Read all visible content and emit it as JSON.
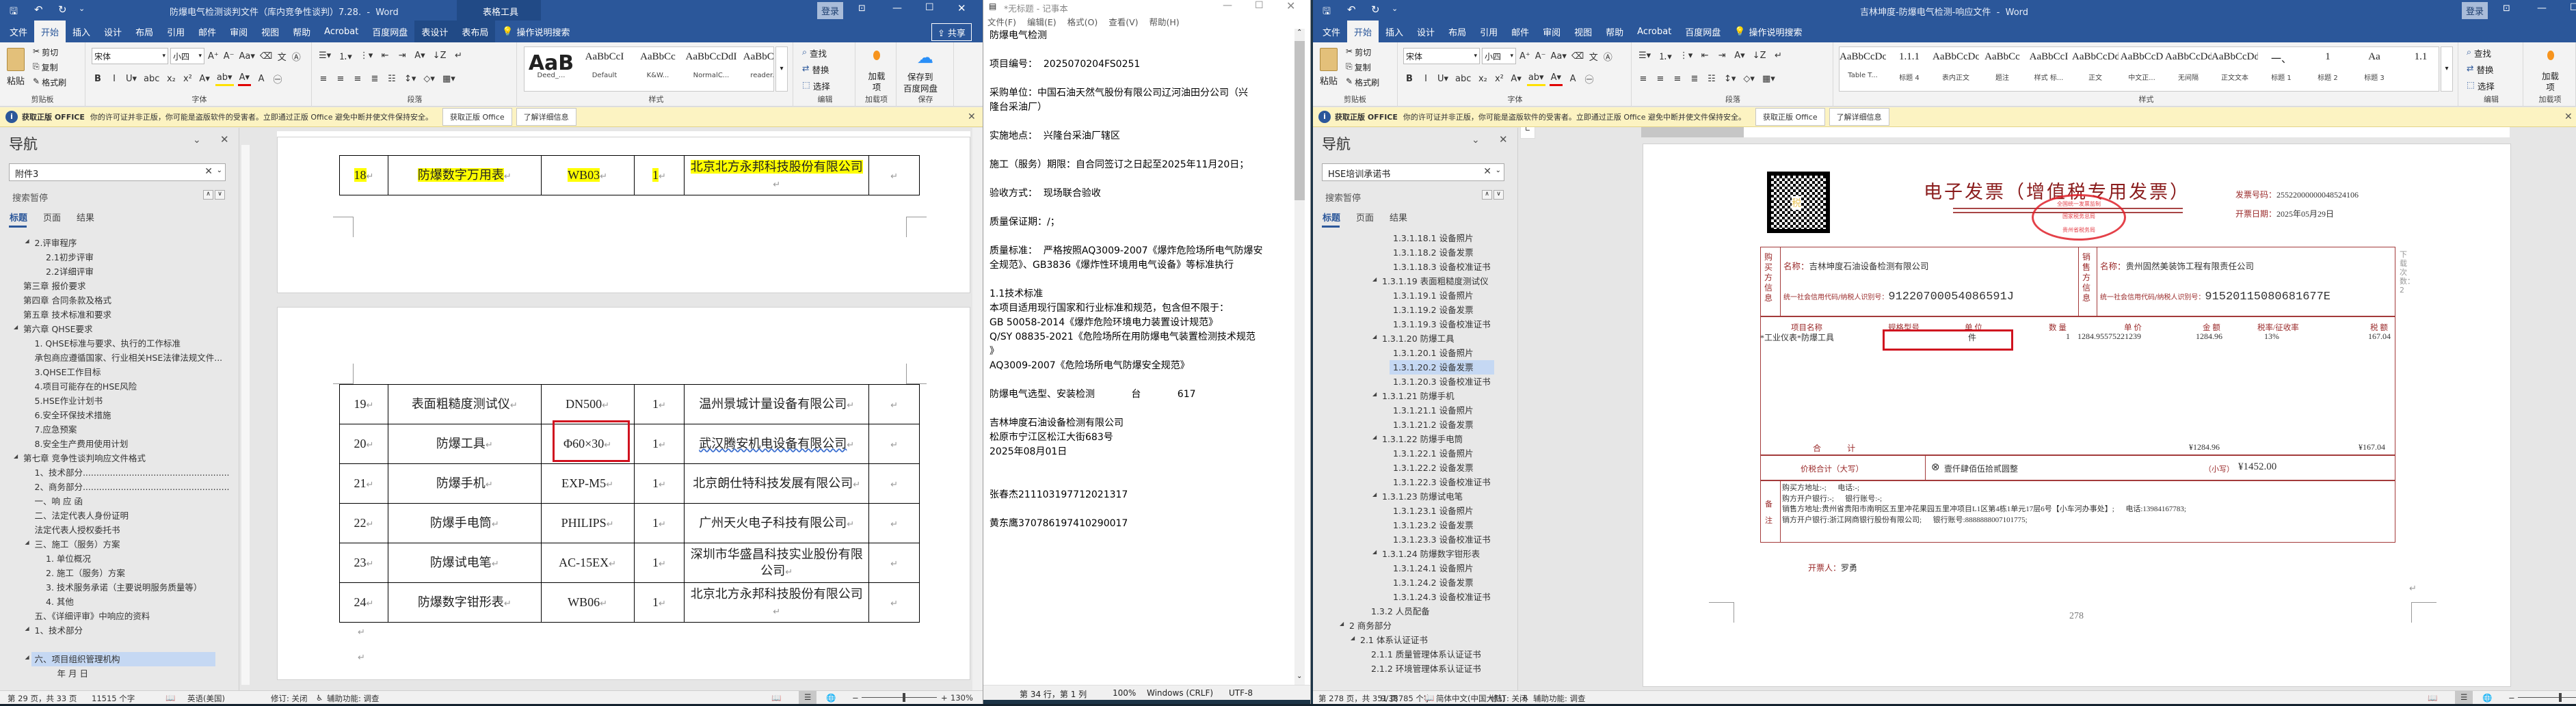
{
  "ribbon_common": {
    "paste": "粘贴",
    "cut": "剪切",
    "copy": "复制",
    "format_painter": "格式刷",
    "clipboard_label": "剪贴板",
    "font_label": "字体",
    "para_label": "段落",
    "styles_label": "样式",
    "find": "查找",
    "replace": "替换",
    "select": "选择",
    "edit_label": "编辑",
    "addins_btn": "加载项",
    "addins_label": "加载项",
    "save_btn_1": "保存到",
    "save_btn_2": "百度网盘",
    "save_label": "保存",
    "font_icons": [
      "grow-font",
      "shrink-font",
      "change-case",
      "clear-format",
      "phonetic-guide",
      "char-border"
    ],
    "format_icons": [
      "bold",
      "italic",
      "underline",
      "strikethrough",
      "subscript",
      "superscript",
      "text-effect",
      "highlight",
      "font-color",
      "char-shading",
      "enclose-char"
    ],
    "para_icons_1": [
      "bullets",
      "numbering",
      "multilevel-list",
      "decrease-indent",
      "increase-indent",
      "asian-layout",
      "sort",
      "show-marks"
    ],
    "para_icons_2": [
      "align-left",
      "align-center",
      "align-right",
      "justify",
      "distributed",
      "line-spacing",
      "shading",
      "borders"
    ]
  },
  "warning": {
    "title": "获取正版 OFFICE",
    "message": "你的许可证并非正版，你可能是盗版软件的受害者。立即通过正版 Office 避免中断并使文件保持安全。",
    "btn_get": "获取正版 Office",
    "btn_learn": "了解详细信息"
  },
  "left_word": {
    "title": "防爆电气检测谈判文件（库内竞争性谈判）7.28.  -  Word",
    "context_tab": "表格工具",
    "signin": "登录",
    "share": "共享",
    "tell_me": "操作说明搜索",
    "tabs": [
      "文件",
      "开始",
      "插入",
      "设计",
      "布局",
      "引用",
      "邮件",
      "审阅",
      "视图",
      "帮助",
      "Acrobat",
      "百度网盘",
      "表设计",
      "表布局"
    ],
    "ribbon": {
      "font_name": "宋体",
      "font_size": "小四",
      "styles": [
        {
          "preview": "AaB",
          "name": "Deed_..."
        },
        {
          "preview": "AaBbCcI",
          "name": "Default"
        },
        {
          "preview": "AaBbCc",
          "name": "K&W..."
        },
        {
          "preview": "AaBbCcDdI",
          "name": "NormalC..."
        },
        {
          "preview": "AaBbCcD",
          "name": "reader..."
        }
      ]
    },
    "nav": {
      "title": "导航",
      "search": "附件3",
      "search_status": "搜索暂停",
      "tabs": [
        "标题",
        "页面",
        "结果"
      ],
      "items": [
        {
          "text": "2.评审程序",
          "level": 1,
          "arrow": true
        },
        {
          "text": "2.1初步评审",
          "level": 2
        },
        {
          "text": "2.2详细评审",
          "level": 2
        },
        {
          "text": "第三章 报价要求",
          "level": 0
        },
        {
          "text": "第四章 合同条款及格式",
          "level": 0
        },
        {
          "text": "第五章 技术标准和要求",
          "level": 0
        },
        {
          "text": "第六章 QHSE要求",
          "level": 0,
          "arrow": true
        },
        {
          "text": "1. QHSE标准与要求、执行的工作标准",
          "level": 1
        },
        {
          "text": "承包商应遵循国家、行业相关HSE法律法规文件...",
          "level": 1
        },
        {
          "text": "3.QHSE工作目标",
          "level": 1
        },
        {
          "text": "4.项目可能存在的HSE风险",
          "level": 1
        },
        {
          "text": "5.HSE作业计划书",
          "level": 1
        },
        {
          "text": "6.安全环保技术措施",
          "level": 1
        },
        {
          "text": "7.应急预案",
          "level": 1
        },
        {
          "text": "8.安全生产费用使用计划",
          "level": 1
        },
        {
          "text": "第七章 竞争性谈判响应文件格式",
          "level": 0,
          "arrow": true
        },
        {
          "text": "1、技术部分......................................................",
          "level": 1
        },
        {
          "text": "2、商务部分......................................................",
          "level": 1
        },
        {
          "text": "一、响 应 函",
          "level": 1
        },
        {
          "text": "二、法定代表人身份证明",
          "level": 1
        },
        {
          "text": "法定代表人授权委托书",
          "level": 1
        },
        {
          "text": "三、施工（服务）方案",
          "level": 1,
          "arrow": true
        },
        {
          "text": "1. 单位概况",
          "level": 2
        },
        {
          "text": "2. 施工（服务）方案",
          "level": 2
        },
        {
          "text": "3. 技术服务承诺（主要说明服务质量等）",
          "level": 2
        },
        {
          "text": "4. 其他",
          "level": 2
        },
        {
          "text": "五、《详细评审》中响应的资料",
          "level": 1
        },
        {
          "text": "1、技术部分",
          "level": 1,
          "arrow": true
        },
        {
          "text": "",
          "level": 1
        },
        {
          "text": "六、项目组织管理机构",
          "level": 1,
          "arrow": true,
          "selected": true
        },
        {
          "text": "年    月    日",
          "level": 3
        }
      ]
    },
    "table_top": [
      [
        "18",
        "防爆数字万用表",
        "WB03",
        "1",
        "北京北方永邦科技股份有限公司"
      ]
    ],
    "table_bottom": [
      [
        "19",
        "表面粗糙度测试仪",
        "DN500",
        "1",
        "温州景城计量设备有限公司"
      ],
      [
        "20",
        "防爆工具",
        "Φ60×30",
        "1",
        "武汉腾安机电设备有限公司"
      ],
      [
        "21",
        "防爆手机",
        "EXP-M5",
        "1",
        "北京朗仕特科技发展有限公司"
      ],
      [
        "22",
        "防爆手电筒",
        "PHILIPS",
        "1",
        "广州天火电子科技有限公司"
      ],
      [
        "23",
        "防爆试电笔",
        "AC-15EX",
        "1",
        "深圳市华盛昌科技实业股份有限公司"
      ],
      [
        "24",
        "防爆数字钳形表",
        "WB06",
        "1",
        "北京北方永邦科技股份有限公司"
      ]
    ],
    "status": {
      "page": "第 29 页，共 33 页",
      "words": "11515 个字",
      "lang": "英语(美国)",
      "track": "修订: 关闭",
      "access": "辅助功能: 调查",
      "zoom": "130%"
    }
  },
  "notepad": {
    "title": "*无标题 - 记事本",
    "menu": [
      "文件(F)",
      "编辑(E)",
      "格式(O)",
      "查看(V)",
      "帮助(H)"
    ],
    "lines": [
      "防爆电气检测",
      "",
      "项目编号：  2025070204FS0251",
      "",
      "采购单位：中国石油天然气股份有限公司辽河油田分公司（兴",
      "隆台采油厂）",
      "",
      "实施地点：  兴隆台采油厂辖区",
      "",
      "施工（服务）期限：自合同签订之日起至2025年11月20日；",
      "",
      "验收方式：  现场联合验收",
      "",
      "质量保证期：/；",
      "",
      "质量标准：  严格按照AQ3009-2007《爆炸危险场所电气防爆安",
      "全规范》、GB3836《爆炸性环境用电气设备》等标准执行",
      "",
      "1.1技术标准",
      "本项目适用现行国家和行业标准和规范，包含但不限于：",
      "GB 50058-2014《爆炸危险环境电力装置设计规范》",
      "Q/SY 08835-2021《危险场所在用防爆电气装置检测技术规范",
      "》",
      "AQ3009-2007《危险场所电气防爆安全规范》",
      "",
      "防爆电气选型、安装检测            台            617",
      "",
      "吉林坤度石油设备检测有限公司",
      "松原市宁江区松江大街683号",
      "2025年08月01日",
      "",
      "",
      "张春杰211103197712021317",
      "",
      "黄东鹰370786197410290017"
    ],
    "status": {
      "position": "第 34 行，第 1 列",
      "zoom": "100%",
      "eol": "Windows (CRLF)",
      "encoding": "UTF-8"
    }
  },
  "right_word": {
    "title": "吉林坤度-防爆电气检测-响应文件  -  Word",
    "signin": "登录",
    "tell_me": "操作说明搜索",
    "tabs": [
      "文件",
      "开始",
      "插入",
      "设计",
      "布局",
      "引用",
      "邮件",
      "审阅",
      "视图",
      "帮助",
      "Acrobat",
      "百度网盘"
    ],
    "ribbon": {
      "font_name": "宋体",
      "font_size": "小四",
      "styles": [
        {
          "preview": "AaBbCcDc",
          "name": "Table T..."
        },
        {
          "preview": "1.1.1",
          "name": "标题 4"
        },
        {
          "preview": "AaBbCcDcI",
          "name": "表内正文"
        },
        {
          "preview": "AaBbCc",
          "name": "题注"
        },
        {
          "preview": "AaBbCcI",
          "name": "样式 标..."
        },
        {
          "preview": "AaBbCcDd",
          "name": "正文"
        },
        {
          "preview": "AaBbCcD",
          "name": "中文正..."
        },
        {
          "preview": "AaBbCcDd",
          "name": "无间隔"
        },
        {
          "preview": "AaBbCcDd",
          "name": "正文文本"
        },
        {
          "preview": "一、",
          "name": "标题 1"
        },
        {
          "preview": "1",
          "name": "标题 2"
        },
        {
          "preview": "Aa",
          "name": "标题 3"
        },
        {
          "preview": "1.1"
        }
      ]
    },
    "nav": {
      "title": "导航",
      "search": "HSE培训承诺书",
      "search_status": "搜索暂停",
      "tabs": [
        "标题",
        "页面",
        "结果"
      ],
      "items": [
        {
          "text": "1.3.1.18.1 设备照片",
          "level": 4
        },
        {
          "text": "1.3.1.18.2 设备发票",
          "level": 4
        },
        {
          "text": "1.3.1.18.3 设备校准证书",
          "level": 4
        },
        {
          "text": "1.3.1.19 表面粗糙度测试仪",
          "level": 3,
          "arrow": true
        },
        {
          "text": "1.3.1.19.1 设备照片",
          "level": 4
        },
        {
          "text": "1.3.1.19.2 设备发票",
          "level": 4
        },
        {
          "text": "1.3.1.19.3 设备校准证书",
          "level": 4
        },
        {
          "text": "1.3.1.20 防爆工具",
          "level": 3,
          "arrow": true
        },
        {
          "text": "1.3.1.20.1 设备照片",
          "level": 4
        },
        {
          "text": "1.3.1.20.2 设备发票",
          "level": 4,
          "selected": true
        },
        {
          "text": "1.3.1.20.3 设备校准证书",
          "level": 4
        },
        {
          "text": "1.3.1.21 防爆手机",
          "level": 3,
          "arrow": true
        },
        {
          "text": "1.3.1.21.1 设备照片",
          "level": 4
        },
        {
          "text": "1.3.1.21.2 设备发票",
          "level": 4
        },
        {
          "text": "1.3.1.22 防爆手电筒",
          "level": 3,
          "arrow": true
        },
        {
          "text": "1.3.1.22.1 设备照片",
          "level": 4
        },
        {
          "text": "1.3.1.22.2 设备发票",
          "level": 4
        },
        {
          "text": "1.3.1.22.3 设备校准证书",
          "level": 4
        },
        {
          "text": "1.3.1.23 防爆试电笔",
          "level": 3,
          "arrow": true
        },
        {
          "text": "1.3.1.23.1 设备照片",
          "level": 4
        },
        {
          "text": "1.3.1.23.2 设备发票",
          "level": 4
        },
        {
          "text": "1.3.1.23.3 设备校准证书",
          "level": 4
        },
        {
          "text": "1.3.1.24 防爆数字钳形表",
          "level": 3,
          "arrow": true
        },
        {
          "text": "1.3.1.24.1 设备照片",
          "level": 4
        },
        {
          "text": "1.3.1.24.2 设备发票",
          "level": 4
        },
        {
          "text": "1.3.1.24.3 设备校准证书",
          "level": 4
        },
        {
          "text": "1.3.2 人员配备",
          "level": 2
        },
        {
          "text": "2 商务部分",
          "level": 0,
          "arrow": true
        },
        {
          "text": "2.1 体系认证证书",
          "level": 1,
          "arrow": true
        },
        {
          "text": "2.1.1 质量管理体系认证证书",
          "level": 2
        },
        {
          "text": "2.1.2 环境管理体系认证证书",
          "level": 2
        }
      ]
    },
    "invoice": {
      "title": "电子发票（增值税专用发票）",
      "qr_char": "税",
      "seal": {
        "top": "全国统一发票监制",
        "middle": "国家税务总局",
        "bottom": "贵州省税务局"
      },
      "number_label": "发票号码：",
      "number": "25522000000048524106",
      "date_label": "开票日期：",
      "date": "2025年05月29日",
      "name_label": "名称：",
      "id_label": "统一社会信用代码/纳税人识别号：",
      "buyer": {
        "side": "购买方信息",
        "name": "吉林坤度石油设备检测有限公司",
        "id": "91220700054086591J"
      },
      "seller": {
        "side": "销售方信息",
        "name": "贵州固然美装饰工程有限责任公司",
        "id": "91520115080681677E"
      },
      "download": "下载次数：2",
      "headers": [
        "项目名称",
        "规格型号",
        "单 位",
        "数 量",
        "单 价",
        "金 额",
        "税率/征收率",
        "税 额"
      ],
      "item": [
        "*工业仪表*防爆工具",
        "",
        "件",
        "1",
        "1284.95575221239",
        "1284.96",
        "13%",
        "167.04"
      ],
      "total_label": "合          计",
      "total_amount": "¥1284.96",
      "total_tax": "¥167.04",
      "grand_label": "价税合计（大写）",
      "grand_words": "壹仟肆佰伍拾贰圆整",
      "grand_small_label": "（小写）",
      "grand_small": "¥1452.00",
      "remarks_label": "备注",
      "remarks": [
        "购买方地址:-;      电话:-;",
        "购方开户银行:-;      银行账号:-;",
        "销售方地址:贵州省贵阳市南明区五里冲花果园五里冲项目L1区第4栋1单元17层6号【小车河办事处】;      电话:13984167783;",
        "销方开户银行:浙江网商银行股份有限公司;      银行账号:8888888007101775;"
      ],
      "issuer_label": "开票人：",
      "issuer": "罗勇",
      "page_number": "278"
    },
    "status": {
      "page": "第 278 页，共 351 页",
      "words": "9/38785 个字",
      "lang": "简体中文(中国大陆)",
      "track": "修订: 关闭",
      "access": "辅助功能: 调查"
    }
  },
  "colors": {
    "word_blue": "#2b579a",
    "invoice_red": "#9a2a2a",
    "seal_red": "#e0202a",
    "highlight": "#ffff00",
    "annotation_box": "#d0121f"
  }
}
